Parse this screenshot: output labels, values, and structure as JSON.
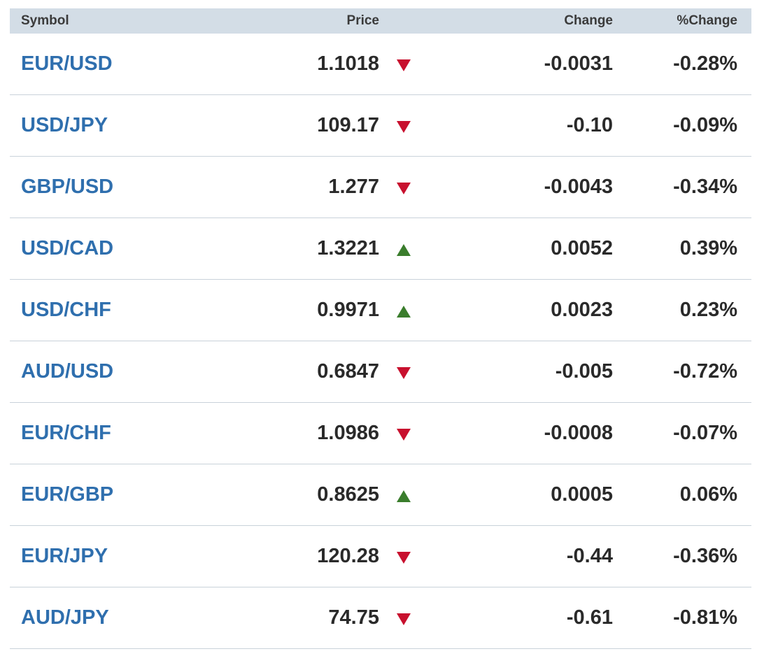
{
  "table": {
    "headers": {
      "symbol": "Symbol",
      "price": "Price",
      "change": "Change",
      "pct": "%Change"
    },
    "rows": [
      {
        "symbol": "EUR/USD",
        "price": "1.1018",
        "direction": "down",
        "change": "-0.0031",
        "pct": "-0.28%"
      },
      {
        "symbol": "USD/JPY",
        "price": "109.17",
        "direction": "down",
        "change": "-0.10",
        "pct": "-0.09%"
      },
      {
        "symbol": "GBP/USD",
        "price": "1.277",
        "direction": "down",
        "change": "-0.0043",
        "pct": "-0.34%"
      },
      {
        "symbol": "USD/CAD",
        "price": "1.3221",
        "direction": "up",
        "change": "0.0052",
        "pct": "0.39%"
      },
      {
        "symbol": "USD/CHF",
        "price": "0.9971",
        "direction": "up",
        "change": "0.0023",
        "pct": "0.23%"
      },
      {
        "symbol": "AUD/USD",
        "price": "0.6847",
        "direction": "down",
        "change": "-0.005",
        "pct": "-0.72%"
      },
      {
        "symbol": "EUR/CHF",
        "price": "1.0986",
        "direction": "down",
        "change": "-0.0008",
        "pct": "-0.07%"
      },
      {
        "symbol": "EUR/GBP",
        "price": "0.8625",
        "direction": "up",
        "change": "0.0005",
        "pct": "0.06%"
      },
      {
        "symbol": "EUR/JPY",
        "price": "120.28",
        "direction": "down",
        "change": "-0.44",
        "pct": "-0.36%"
      },
      {
        "symbol": "AUD/JPY",
        "price": "74.75",
        "direction": "down",
        "change": "-0.61",
        "pct": "-0.81%"
      }
    ]
  },
  "colors": {
    "header_bg": "#d3dde6",
    "symbol_link": "#2f6fae",
    "down_arrow": "#c8102e",
    "up_arrow": "#3a7d2c",
    "row_divider": "#c9d2da"
  }
}
